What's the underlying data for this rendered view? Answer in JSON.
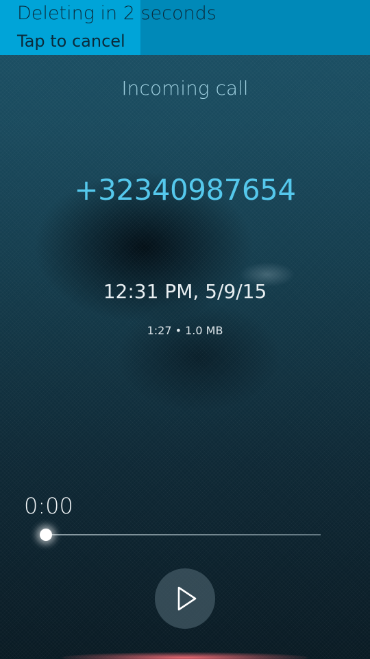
{
  "remorse": {
    "title": "Deleting in 2 seconds",
    "subtitle": "Tap to cancel",
    "progress_fraction": 0.38,
    "accent_color": "#00a4d8"
  },
  "recording": {
    "call_type": "Incoming call",
    "phone_number": "+32340987654",
    "datetime": "12:31 PM, 5/9/15",
    "meta": "1:27 • 1.0 MB"
  },
  "player": {
    "position_label": "0:00",
    "position_fraction": 0.0,
    "play_icon": "play-icon"
  },
  "colors": {
    "number": "#55c8ec",
    "indicator_glow": "#ff6e78"
  }
}
